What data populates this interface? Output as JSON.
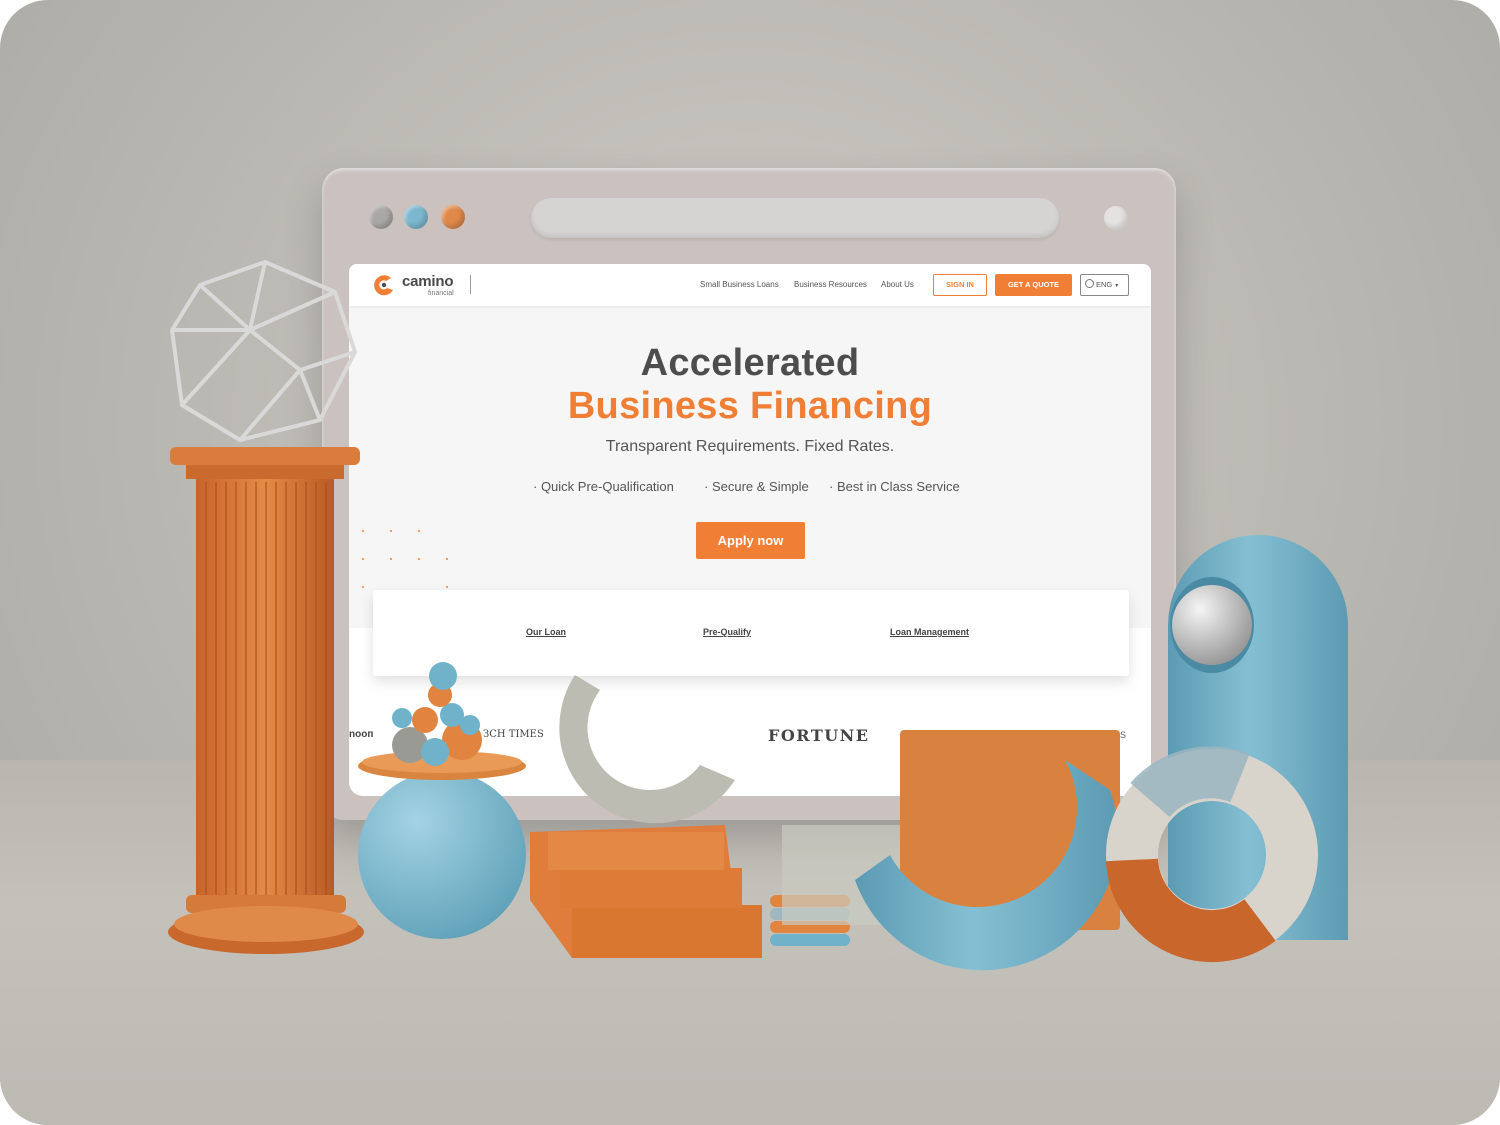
{
  "brand": {
    "name": "camino",
    "sub": "financial",
    "accent": "#f07f35",
    "text": "#4d4d4d"
  },
  "window_dots": [
    "#aaa8a5",
    "#7bb7cf",
    "#e0894a"
  ],
  "nav": {
    "items": [
      "Small Business Loans",
      "Business Resources",
      "About Us"
    ],
    "sign_in": "SIGN IN",
    "get_quote": "GET A QUOTE",
    "language": "ENG"
  },
  "hero": {
    "title_line1": "Accelerated",
    "title_line2": "Business Financing",
    "subtitle": "Transparent Requirements. Fixed Rates.",
    "bullets": [
      "· Quick Pre-Qualification",
      "· Secure & Simple",
      "· Best in Class Service"
    ],
    "cta": "Apply now"
  },
  "tabs": [
    "Our Loan",
    "Pre-Qualify",
    "Loan Management"
  ],
  "press": [
    "FORTUNE"
  ],
  "press_partial": [
    "nooп",
    "ЗCH TIMES",
    "REUTERS"
  ]
}
